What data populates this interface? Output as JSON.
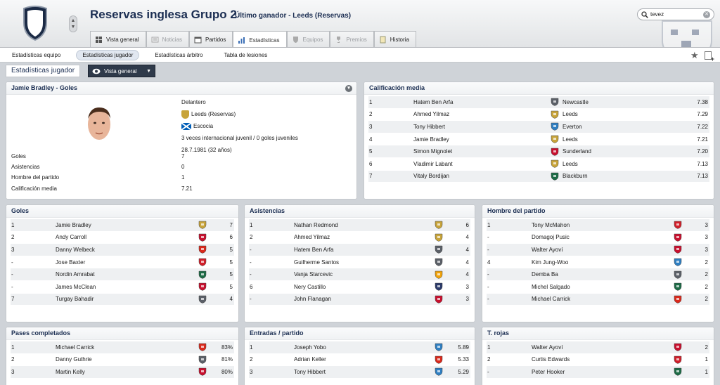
{
  "header": {
    "title": "Reservas inglesa Grupo 2",
    "subtitle": "Último ganador - Leeds (Reservas)"
  },
  "tabs": [
    {
      "label": "Vista general",
      "icon": "grid-icon",
      "state": "normal"
    },
    {
      "label": "Noticias",
      "icon": "news-icon",
      "state": "disabled"
    },
    {
      "label": "Partidos",
      "icon": "calendar-icon",
      "state": "normal"
    },
    {
      "label": "Estadísticas",
      "icon": "stats-icon",
      "state": "active"
    },
    {
      "label": "Equipos",
      "icon": "shield-icon",
      "state": "disabled"
    },
    {
      "label": "Premios",
      "icon": "trophy-icon",
      "state": "disabled"
    },
    {
      "label": "Historia",
      "icon": "book-icon",
      "state": "normal"
    }
  ],
  "search": {
    "value": "tevez"
  },
  "subnav": [
    "Estadísticas equipo",
    "Estadísticas jugador",
    "Estadísticas árbitro",
    "Tabla de lesiones"
  ],
  "subnav_active": 1,
  "viewbar": {
    "title": "Estadísticas jugador",
    "button": "Vista general"
  },
  "player": {
    "heading": "Jamie Bradley - Goles",
    "position": "Delantero",
    "club": "Leeds (Reservas)",
    "nation": "Escocia",
    "caps": "3 veces internacional juvenil / 0 goles juveniles",
    "dob": "28.7.1981 (32 años)",
    "stats": [
      {
        "k": "Goles",
        "v": "7"
      },
      {
        "k": "Asistencias",
        "v": "0"
      },
      {
        "k": "Hombre del partido",
        "v": "1"
      },
      {
        "k": "Calificación media",
        "v": "7.21"
      }
    ]
  },
  "rating": {
    "title": "Calificación media",
    "rows": [
      {
        "pos": "1",
        "name": "Hatem Ben Arfa",
        "club": "Newcastle",
        "badge": "newcastle",
        "val": "7.38"
      },
      {
        "pos": "2",
        "name": "Ahmed Yilmaz",
        "club": "Leeds",
        "badge": "leeds",
        "val": "7.29"
      },
      {
        "pos": "3",
        "name": "Tony Hibbert",
        "club": "Everton",
        "badge": "everton",
        "val": "7.22"
      },
      {
        "pos": "4",
        "name": "Jamie Bradley",
        "club": "Leeds",
        "badge": "leeds",
        "val": "7.21"
      },
      {
        "pos": "5",
        "name": "Simon Mignolet",
        "club": "Sunderland",
        "badge": "sunderland",
        "val": "7.20"
      },
      {
        "pos": "6",
        "name": "Vladimir Labant",
        "club": "Leeds",
        "badge": "leeds",
        "val": "7.13"
      },
      {
        "pos": "7",
        "name": "Vitaly Bordijan",
        "club": "Blackburn",
        "badge": "blackburn",
        "val": "7.13"
      }
    ]
  },
  "panels": [
    {
      "title": "Goles",
      "rows": [
        {
          "pos": "1",
          "name": "Jamie Bradley",
          "badge": "leeds",
          "val": "7"
        },
        {
          "pos": "2",
          "name": "Andy Carroll",
          "badge": "liverpool",
          "val": "6"
        },
        {
          "pos": "3",
          "name": "Danny Welbeck",
          "badge": "manutd",
          "val": "5"
        },
        {
          "pos": "-",
          "name": "Jose Baxter",
          "badge": "middlesbrough",
          "val": "5"
        },
        {
          "pos": "-",
          "name": "Nordin Amrabat",
          "badge": "blackburn",
          "val": "5"
        },
        {
          "pos": "-",
          "name": "James McClean",
          "badge": "sunderland",
          "val": "5"
        },
        {
          "pos": "7",
          "name": "Turgay Bahadir",
          "badge": "newcastle",
          "val": "4"
        }
      ]
    },
    {
      "title": "Asistencias",
      "rows": [
        {
          "pos": "1",
          "name": "Nathan Redmond",
          "badge": "leeds",
          "val": "6"
        },
        {
          "pos": "2",
          "name": "Ahmed Yilmaz",
          "badge": "leeds",
          "val": "4"
        },
        {
          "pos": "-",
          "name": "Hatem Ben Arfa",
          "badge": "newcastle",
          "val": "4"
        },
        {
          "pos": "-",
          "name": "Guilherme Santos",
          "badge": "newcastle",
          "val": "4"
        },
        {
          "pos": "-",
          "name": "Vanja Starcevic",
          "badge": "wolves",
          "val": "4"
        },
        {
          "pos": "6",
          "name": "Nery Castillo",
          "badge": "tottenham",
          "val": "3"
        },
        {
          "pos": "-",
          "name": "John Flanagan",
          "badge": "liverpool",
          "val": "3"
        }
      ]
    },
    {
      "title": "Hombre del partido",
      "rows": [
        {
          "pos": "1",
          "name": "Tony McMahon",
          "badge": "middlesbrough",
          "val": "3"
        },
        {
          "pos": "-",
          "name": "Domagoj Pusic",
          "badge": "liverpool",
          "val": "3"
        },
        {
          "pos": "-",
          "name": "Walter Ayoví",
          "badge": "sunderland",
          "val": "3"
        },
        {
          "pos": "4",
          "name": "Kim Jung-Woo",
          "badge": "everton",
          "val": "2"
        },
        {
          "pos": "-",
          "name": "Demba Ba",
          "badge": "newcastle",
          "val": "2"
        },
        {
          "pos": "-",
          "name": "Michel Salgado",
          "badge": "blackburn",
          "val": "2"
        },
        {
          "pos": "-",
          "name": "Michael Carrick",
          "badge": "manutd",
          "val": "2"
        }
      ]
    },
    {
      "title": "Pases completados",
      "rows": [
        {
          "pos": "1",
          "name": "Michael Carrick",
          "badge": "manutd",
          "val": "83%"
        },
        {
          "pos": "2",
          "name": "Danny Guthrie",
          "badge": "newcastle",
          "val": "81%"
        },
        {
          "pos": "3",
          "name": "Martin Kelly",
          "badge": "liverpool",
          "val": "80%"
        }
      ]
    },
    {
      "title": "Entradas / partido",
      "rows": [
        {
          "pos": "1",
          "name": "Joseph Yobo",
          "badge": "everton",
          "val": "5.89"
        },
        {
          "pos": "2",
          "name": "Adrian Keller",
          "badge": "manutd",
          "val": "5.33"
        },
        {
          "pos": "3",
          "name": "Tony Hibbert",
          "badge": "everton",
          "val": "5.29"
        }
      ]
    },
    {
      "title": "T. rojas",
      "rows": [
        {
          "pos": "1",
          "name": "Walter Ayoví",
          "badge": "sunderland",
          "val": "2"
        },
        {
          "pos": "2",
          "name": "Curtis Edwards",
          "badge": "middlesbrough",
          "val": "1"
        },
        {
          "pos": "-",
          "name": "Peter Hooker",
          "badge": "blackburn",
          "val": "1"
        }
      ]
    }
  ],
  "colors": {
    "leeds": "#c8a43a",
    "liverpool": "#c8102e",
    "manutd": "#da291c",
    "middlesbrough": "#d11f2a",
    "blackburn": "#1d6b46",
    "sunderland": "#c8102e",
    "newcastle": "#5b6068",
    "everton": "#2f7fc2",
    "wolves": "#f1a30b",
    "tottenham": "#2b3a6a"
  }
}
